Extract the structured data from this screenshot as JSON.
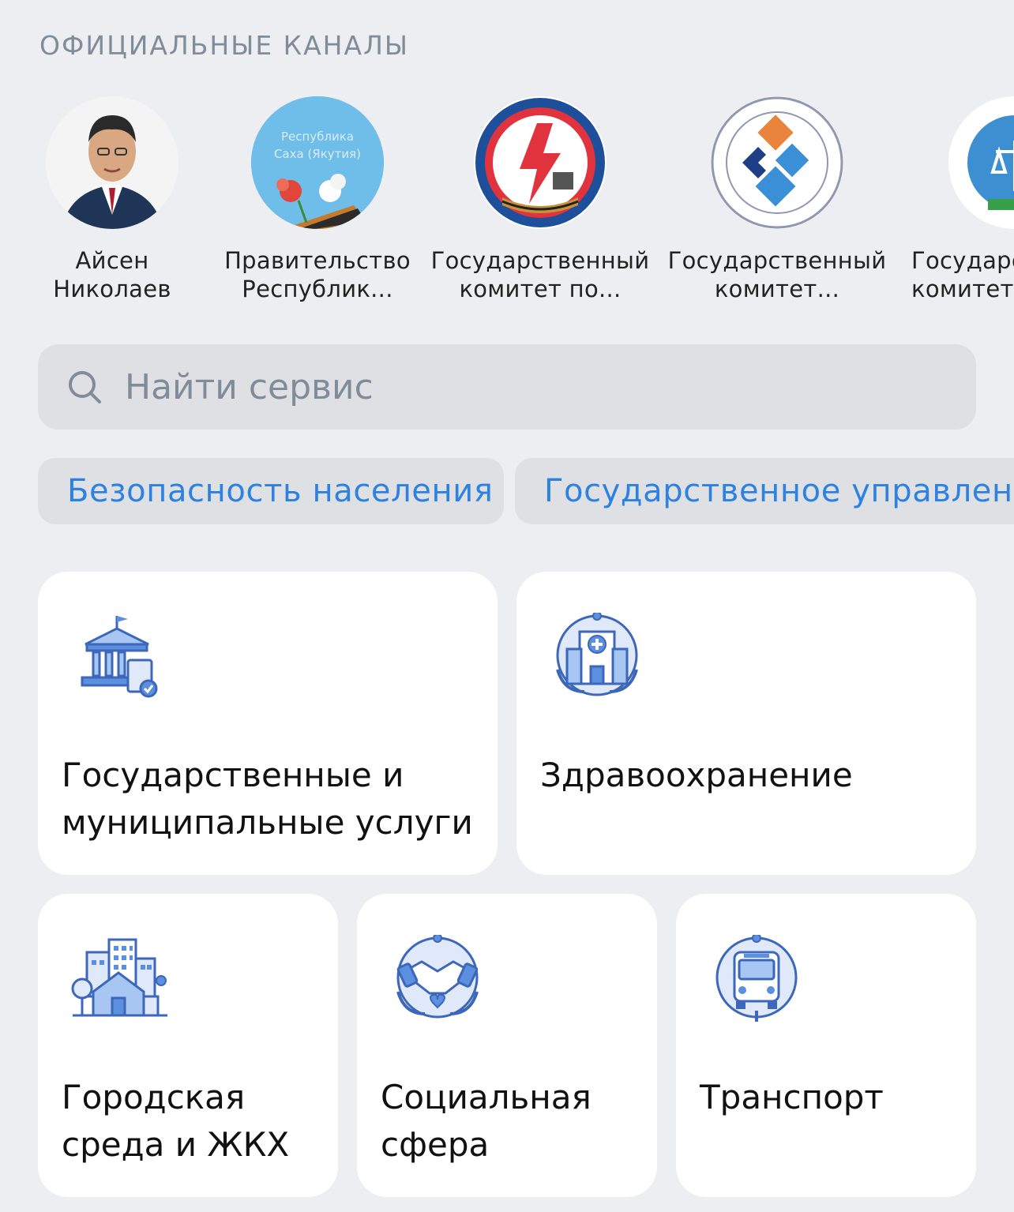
{
  "section_title": "ОФИЦИАЛЬНЫЕ КАНАЛЫ",
  "channels": [
    {
      "line1": "Айсен",
      "line2": "Николаев",
      "icon": "portrait-avatar"
    },
    {
      "line1": "Правительство",
      "line2": "Республик...",
      "icon": "republic-flowers-avatar",
      "avatar_text_1": "Республика",
      "avatar_text_2": "Саха (Якутия)"
    },
    {
      "line1": "Государственный",
      "line2": "комитет по...",
      "icon": "red-emblem-avatar"
    },
    {
      "line1": "Государственный",
      "line2": "комитет...",
      "icon": "diamond-emblem-avatar"
    },
    {
      "line1": "Государс",
      "line2": "комитет",
      "icon": "scales-emblem-avatar"
    }
  ],
  "search": {
    "placeholder": "Найти сервис",
    "icon": "search-icon"
  },
  "chips": [
    "Безопасность населения",
    "Государственное управление"
  ],
  "cards": [
    {
      "line1": "Государственные и",
      "line2": "муниципальные услуги",
      "icon": "government-building-icon"
    },
    {
      "line1": "Здравоохранение",
      "line2": "",
      "icon": "hospital-icon"
    },
    {
      "line1": "Городская",
      "line2": "среда и ЖКХ",
      "icon": "city-buildings-icon"
    },
    {
      "line1": "Социальная",
      "line2": "сфера",
      "icon": "handshake-icon"
    },
    {
      "line1": "Транспорт",
      "line2": "",
      "icon": "bus-icon"
    }
  ],
  "colors": {
    "accent": "#2d81e0",
    "background": "#edeef2",
    "icon_blue": "#4a7fd6",
    "muted": "#818c99"
  }
}
